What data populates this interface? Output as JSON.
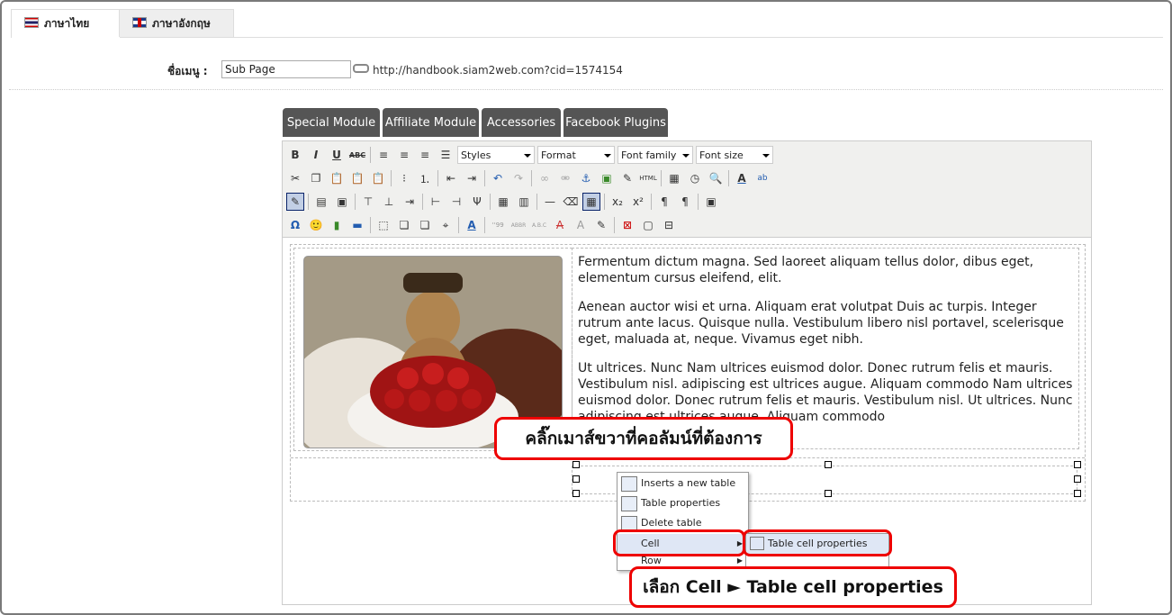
{
  "tabs": [
    {
      "label": "ภาษาไทย",
      "flag": "thai-flag-icon",
      "active": true
    },
    {
      "label": "ภาษาอังกฤษ",
      "flag": "uk-flag-icon",
      "active": false
    }
  ],
  "menu_name": {
    "label": "ชื่อเมนู :",
    "value": "Sub Page",
    "url": "http://handbook.siam2web.com?cid=1574154"
  },
  "module_buttons": [
    "Special Module",
    "Affiliate Module",
    "Accessories",
    "Facebook Plugins"
  ],
  "toolbar": {
    "styles": "Styles",
    "format": "Format",
    "font_family": "Font family",
    "font_size": "Font size"
  },
  "content": {
    "paragraphs": [
      "Fermentum dictum magna. Sed laoreet aliquam tellus dolor, dibus eget, elementum cursus eleifend, elit.",
      "Aenean auctor wisi et urna. Aliquam erat volutpat Duis ac turpis. Integer rutrum ante lacus. Quisque nulla. Vestibulum libero nisl portavel, scelerisque eget, maluada at, neque. Vivamus eget nibh.",
      "Ut ultrices. Nunc Nam ultrices euismod dolor. Donec rutrum felis et mauris. Vestibulum nisl. adipiscing est ultrices augue. Aliquam commodo Nam ultrices euismod dolor. Donec rutrum felis et mauris. Vestibulum nisl. Ut ultrices. Nunc adipiscing est ultrices augue. Aliquam commodo"
    ]
  },
  "context_menu": {
    "items": [
      {
        "label": "Inserts a new table",
        "icon": "insert-table-icon"
      },
      {
        "label": "Table properties",
        "icon": "table-properties-icon"
      },
      {
        "label": "Delete table",
        "icon": "delete-table-icon"
      },
      {
        "label": "Cell",
        "icon": "",
        "submenu": true
      },
      {
        "label": "Row",
        "icon": "",
        "submenu": true
      }
    ],
    "submenu": [
      "Table cell properties"
    ]
  },
  "callouts": {
    "top": "คลิ๊กเมาส์ขวาที่คอลัมน์ที่ต้องการ",
    "bottom": "เลือก Cell ► Table cell properties"
  },
  "colors": {
    "accent": "#e00000",
    "module_button_bg": "#555555"
  }
}
